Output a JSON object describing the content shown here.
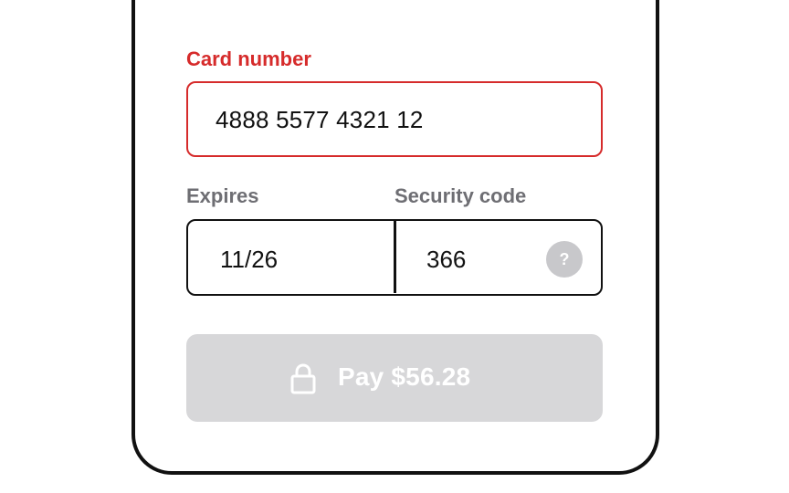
{
  "form": {
    "card_number": {
      "label": "Card number",
      "value": "4888 5577 4321 12",
      "state": "error"
    },
    "expires": {
      "label": "Expires",
      "value": "11/26"
    },
    "security_code": {
      "label": "Security code",
      "value": "366",
      "help_icon": "question-mark"
    },
    "pay_button": {
      "label": "Pay $56.28",
      "icon": "lock-icon",
      "state": "disabled"
    }
  },
  "colors": {
    "error": "#d62b2b",
    "label_muted": "#6e6e73",
    "border": "#111111",
    "button_disabled": "#d7d7d9",
    "help_icon_bg": "#c8c8cb"
  }
}
